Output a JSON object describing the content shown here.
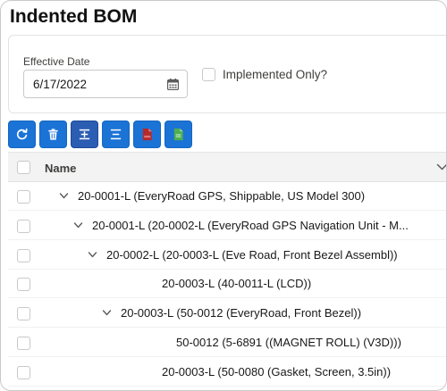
{
  "page": {
    "title": "Indented BOM"
  },
  "filters": {
    "effective_date_label": "Effective Date",
    "effective_date_value": "6/17/2022",
    "implemented_only_label": "Implemented Only?",
    "implemented_only_checked": false
  },
  "toolbar": {
    "buttons": [
      {
        "name": "refresh",
        "icon": "refresh-icon"
      },
      {
        "name": "delete",
        "icon": "trash-icon"
      },
      {
        "name": "expand-all",
        "icon": "expand-icon",
        "active": true
      },
      {
        "name": "collapse-all",
        "icon": "collapse-icon"
      },
      {
        "name": "export-pdf",
        "icon": "pdf-file-icon"
      },
      {
        "name": "export-excel",
        "icon": "excel-file-icon"
      }
    ]
  },
  "grid": {
    "column_name": "Name",
    "rows": [
      {
        "text": "20-0001-L (EveryRoad GPS, Shippable, US Model 300)",
        "level": 0,
        "expanded": true
      },
      {
        "text": "20-0001-L (20-0002-L (EveryRoad GPS Navigation Unit - M...",
        "level": 1,
        "expanded": true
      },
      {
        "text": "20-0002-L (20-0003-L (Eve Road, Front Bezel Assembl))",
        "level": 2,
        "expanded": true
      },
      {
        "text": "20-0003-L (40-0011-L (LCD))",
        "level": 3,
        "expanded": null
      },
      {
        "text": "20-0003-L (50-0012 (EveryRoad, Front Bezel))",
        "level": 3,
        "expanded": true
      },
      {
        "text": "50-0012 (5-6891 ((MAGNET ROLL) (V3D)))",
        "level": 4,
        "expanded": null
      },
      {
        "text": "20-0003-L (50-0080 (Gasket, Screen, 3.5in))",
        "level": 3,
        "expanded": null
      }
    ]
  },
  "colors": {
    "accent": "#1b73d6",
    "pdf": "#b52a2a",
    "excel": "#4caf50"
  }
}
